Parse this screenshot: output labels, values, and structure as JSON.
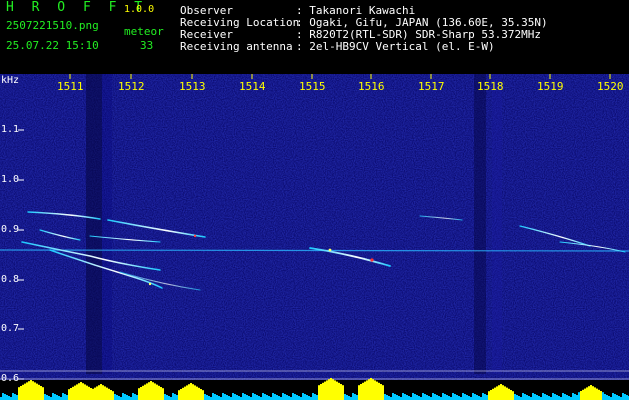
{
  "app": {
    "logo": "H R O F F T",
    "version": "1.0.0",
    "filename": "2507221510.png",
    "datetime": "25.07.22 15:10",
    "meteor_label": "meteor",
    "meteor_count": "33"
  },
  "info": {
    "rows": [
      {
        "label": "Observer",
        "value": ": Takanori Kawachi"
      },
      {
        "label": "Receiving Location",
        "value": ": Ogaki, Gifu, JAPAN (136.60E, 35.35N)"
      },
      {
        "label": "Receiver",
        "value": ": R820T2(RTL-SDR) SDR-Sharp 53.372MHz"
      },
      {
        "label": "Receiving antenna",
        "value": ": 2el-HB9CV Vertical (el. E-W)"
      }
    ]
  },
  "axes": {
    "unit": "kHz",
    "time_labels": [
      "1511",
      "1512",
      "1513",
      "1514",
      "1515",
      "1516",
      "1517",
      "1518",
      "1519",
      "1520"
    ],
    "freq_labels": [
      "1.1",
      "1.0",
      "0.9",
      "0.8",
      "0.7",
      "0.6"
    ],
    "freq_values": [
      1.1,
      1.0,
      0.9,
      0.8,
      0.7,
      0.6
    ]
  },
  "colors": {
    "background": "#0a0a6e",
    "header_green": "#22ee22",
    "header_white": "#ffffff",
    "label_yellow": "#ffff00",
    "histogram_yellow": "#ffff00",
    "histogram_cyan": "#00c8ff"
  }
}
